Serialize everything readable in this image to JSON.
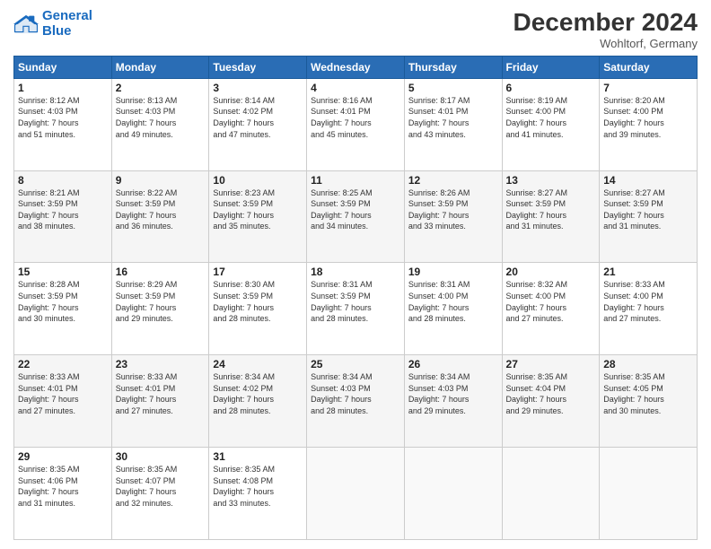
{
  "logo": {
    "line1": "General",
    "line2": "Blue"
  },
  "title": "December 2024",
  "subtitle": "Wohltorf, Germany",
  "days_header": [
    "Sunday",
    "Monday",
    "Tuesday",
    "Wednesday",
    "Thursday",
    "Friday",
    "Saturday"
  ],
  "weeks": [
    [
      {
        "day": "1",
        "info": "Sunrise: 8:12 AM\nSunset: 4:03 PM\nDaylight: 7 hours\nand 51 minutes."
      },
      {
        "day": "2",
        "info": "Sunrise: 8:13 AM\nSunset: 4:03 PM\nDaylight: 7 hours\nand 49 minutes."
      },
      {
        "day": "3",
        "info": "Sunrise: 8:14 AM\nSunset: 4:02 PM\nDaylight: 7 hours\nand 47 minutes."
      },
      {
        "day": "4",
        "info": "Sunrise: 8:16 AM\nSunset: 4:01 PM\nDaylight: 7 hours\nand 45 minutes."
      },
      {
        "day": "5",
        "info": "Sunrise: 8:17 AM\nSunset: 4:01 PM\nDaylight: 7 hours\nand 43 minutes."
      },
      {
        "day": "6",
        "info": "Sunrise: 8:19 AM\nSunset: 4:00 PM\nDaylight: 7 hours\nand 41 minutes."
      },
      {
        "day": "7",
        "info": "Sunrise: 8:20 AM\nSunset: 4:00 PM\nDaylight: 7 hours\nand 39 minutes."
      }
    ],
    [
      {
        "day": "8",
        "info": "Sunrise: 8:21 AM\nSunset: 3:59 PM\nDaylight: 7 hours\nand 38 minutes."
      },
      {
        "day": "9",
        "info": "Sunrise: 8:22 AM\nSunset: 3:59 PM\nDaylight: 7 hours\nand 36 minutes."
      },
      {
        "day": "10",
        "info": "Sunrise: 8:23 AM\nSunset: 3:59 PM\nDaylight: 7 hours\nand 35 minutes."
      },
      {
        "day": "11",
        "info": "Sunrise: 8:25 AM\nSunset: 3:59 PM\nDaylight: 7 hours\nand 34 minutes."
      },
      {
        "day": "12",
        "info": "Sunrise: 8:26 AM\nSunset: 3:59 PM\nDaylight: 7 hours\nand 33 minutes."
      },
      {
        "day": "13",
        "info": "Sunrise: 8:27 AM\nSunset: 3:59 PM\nDaylight: 7 hours\nand 31 minutes."
      },
      {
        "day": "14",
        "info": "Sunrise: 8:27 AM\nSunset: 3:59 PM\nDaylight: 7 hours\nand 31 minutes."
      }
    ],
    [
      {
        "day": "15",
        "info": "Sunrise: 8:28 AM\nSunset: 3:59 PM\nDaylight: 7 hours\nand 30 minutes."
      },
      {
        "day": "16",
        "info": "Sunrise: 8:29 AM\nSunset: 3:59 PM\nDaylight: 7 hours\nand 29 minutes."
      },
      {
        "day": "17",
        "info": "Sunrise: 8:30 AM\nSunset: 3:59 PM\nDaylight: 7 hours\nand 28 minutes."
      },
      {
        "day": "18",
        "info": "Sunrise: 8:31 AM\nSunset: 3:59 PM\nDaylight: 7 hours\nand 28 minutes."
      },
      {
        "day": "19",
        "info": "Sunrise: 8:31 AM\nSunset: 4:00 PM\nDaylight: 7 hours\nand 28 minutes."
      },
      {
        "day": "20",
        "info": "Sunrise: 8:32 AM\nSunset: 4:00 PM\nDaylight: 7 hours\nand 27 minutes."
      },
      {
        "day": "21",
        "info": "Sunrise: 8:33 AM\nSunset: 4:00 PM\nDaylight: 7 hours\nand 27 minutes."
      }
    ],
    [
      {
        "day": "22",
        "info": "Sunrise: 8:33 AM\nSunset: 4:01 PM\nDaylight: 7 hours\nand 27 minutes."
      },
      {
        "day": "23",
        "info": "Sunrise: 8:33 AM\nSunset: 4:01 PM\nDaylight: 7 hours\nand 27 minutes."
      },
      {
        "day": "24",
        "info": "Sunrise: 8:34 AM\nSunset: 4:02 PM\nDaylight: 7 hours\nand 28 minutes."
      },
      {
        "day": "25",
        "info": "Sunrise: 8:34 AM\nSunset: 4:03 PM\nDaylight: 7 hours\nand 28 minutes."
      },
      {
        "day": "26",
        "info": "Sunrise: 8:34 AM\nSunset: 4:03 PM\nDaylight: 7 hours\nand 29 minutes."
      },
      {
        "day": "27",
        "info": "Sunrise: 8:35 AM\nSunset: 4:04 PM\nDaylight: 7 hours\nand 29 minutes."
      },
      {
        "day": "28",
        "info": "Sunrise: 8:35 AM\nSunset: 4:05 PM\nDaylight: 7 hours\nand 30 minutes."
      }
    ],
    [
      {
        "day": "29",
        "info": "Sunrise: 8:35 AM\nSunset: 4:06 PM\nDaylight: 7 hours\nand 31 minutes."
      },
      {
        "day": "30",
        "info": "Sunrise: 8:35 AM\nSunset: 4:07 PM\nDaylight: 7 hours\nand 32 minutes."
      },
      {
        "day": "31",
        "info": "Sunrise: 8:35 AM\nSunset: 4:08 PM\nDaylight: 7 hours\nand 33 minutes."
      },
      {
        "day": "",
        "info": ""
      },
      {
        "day": "",
        "info": ""
      },
      {
        "day": "",
        "info": ""
      },
      {
        "day": "",
        "info": ""
      }
    ]
  ]
}
